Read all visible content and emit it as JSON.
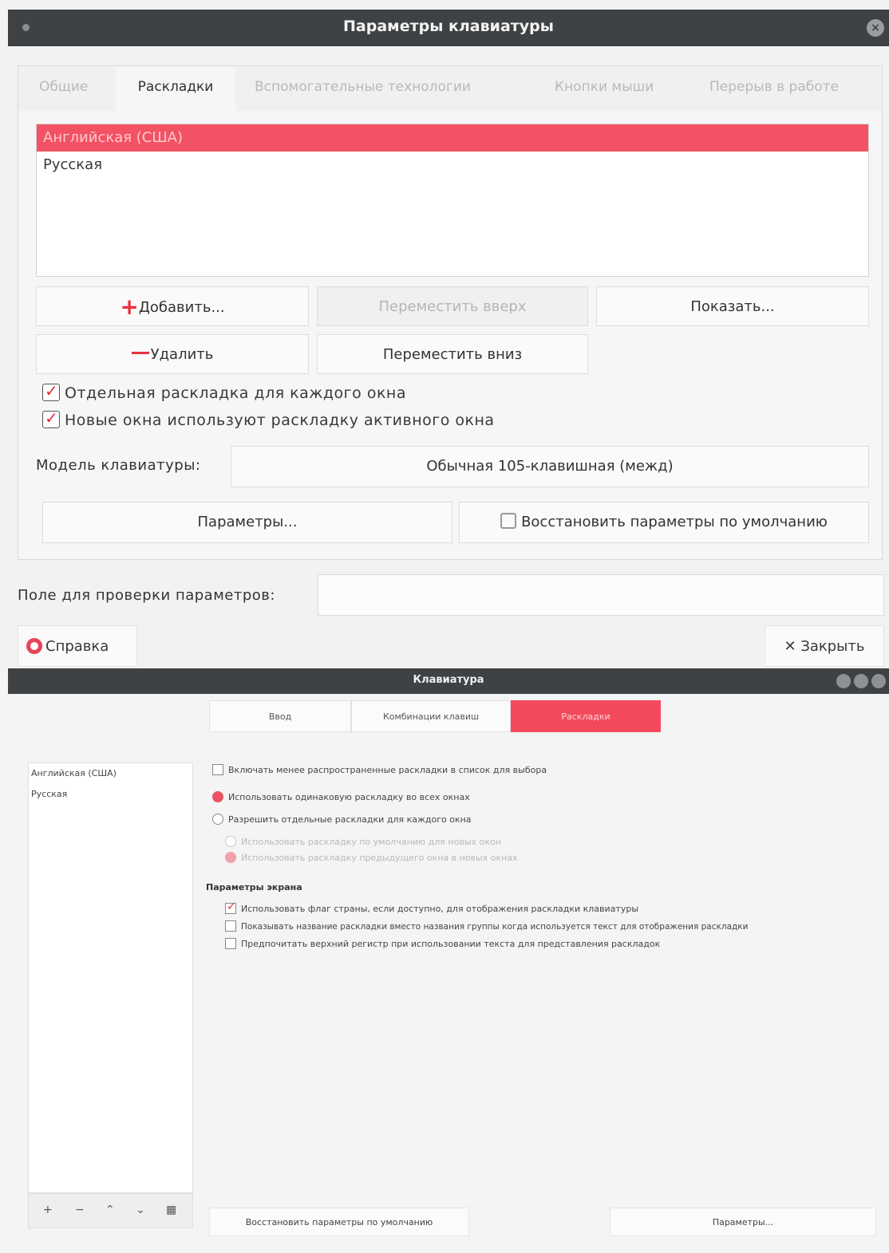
{
  "window1": {
    "title": "Параметры клавиатуры",
    "tabs": [
      {
        "label": "Общие"
      },
      {
        "label": "Раскладки"
      },
      {
        "label": "Вспомогательные технологии"
      },
      {
        "label": "Кнопки мыши"
      },
      {
        "label": "Перерыв в работе"
      }
    ],
    "active_tab": "Раскладки",
    "layouts": [
      "Английская (США)",
      "Русская"
    ],
    "selected_layout": "Английская (США)",
    "buttons": {
      "add": "Добавить...",
      "move_up": "Переместить вверх",
      "show": "Показать...",
      "remove": "Удалить",
      "move_down": "Переместить вниз",
      "options": "Параметры...",
      "restore": "Восстановить параметры по умолчанию"
    },
    "checkboxes": [
      {
        "label": "Отдельная раскладка для каждого окна",
        "checked": true
      },
      {
        "label": "Новые окна используют раскладку активного окна",
        "checked": true
      }
    ],
    "model_label": "Модель клавиатуры:",
    "model_value": "Обычная 105-клавишная (межд)",
    "test_label": "Поле для проверки параметров:",
    "test_value": "",
    "help": "Справка",
    "close": "Закрыть"
  },
  "window2": {
    "title": "Клавиатура",
    "tabs": [
      {
        "label": "Ввод"
      },
      {
        "label": "Комбинации клавиш"
      },
      {
        "label": "Раскладки"
      }
    ],
    "active_tab": "Раскладки",
    "layouts": [
      "Английская (США)",
      "Русская"
    ],
    "options": {
      "include_rare": "Включать менее распространенные раскладки в список для выбора",
      "same_layout": "Использовать одинаковую раскладку во всех окнах",
      "separate_layout": "Разрешить отдельные раскладки для каждого окна",
      "default_new": "Использовать раскладку по умолчанию для новых окон",
      "prev_new": "Использовать раскладку предыдущего окна в новых окнах"
    },
    "display_section": "Параметры экрана",
    "display": {
      "flag": "Использовать флаг страны, если доступно, для отображения раскладки клавиатуры",
      "layout_name": "Показывать название раскладки вместо названия группы когда используется текст для отображения раскладки",
      "uppercase": "Предпочитать верхний регистр при использовании текста для представления раскладок"
    },
    "restore": "Восстановить параметры по умолчанию",
    "options_btn": "Параметры..."
  }
}
